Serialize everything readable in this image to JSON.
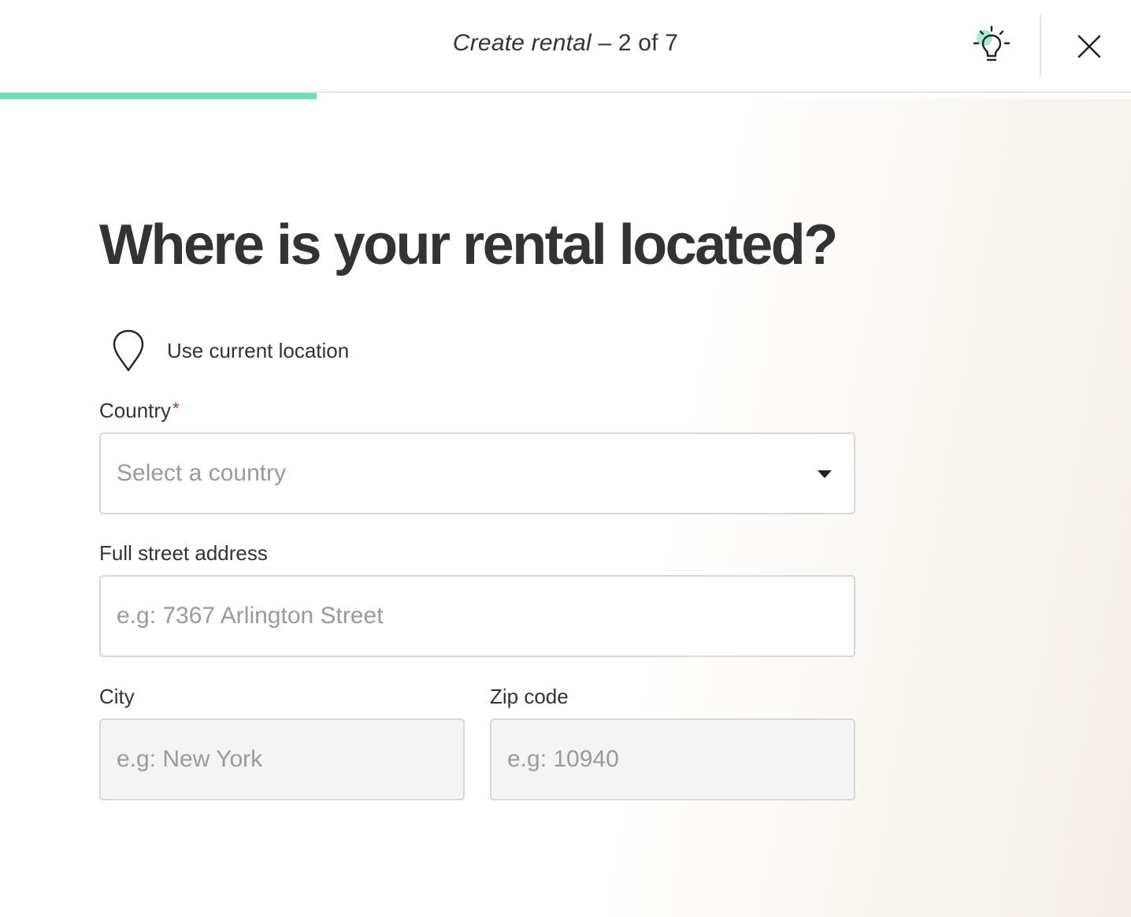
{
  "header": {
    "title_main": "Create rental",
    "title_step": " – 2 of 7",
    "idea_icon": "lightbulb-icon",
    "close_icon": "close-icon"
  },
  "progress": {
    "current_step": 2,
    "total_steps": 7,
    "fill_fraction": 0.28,
    "color": "#6fddb8"
  },
  "main": {
    "heading": "Where is your rental located?",
    "use_location": {
      "icon": "map-pin-icon",
      "label": "Use current location"
    }
  },
  "form": {
    "country": {
      "label": "Country",
      "required_mark": "*",
      "placeholder": "Select a country"
    },
    "street": {
      "label": "Full street address",
      "placeholder": "e.g: 7367 Arlington Street"
    },
    "city": {
      "label": "City",
      "placeholder": "e.g: New York"
    },
    "zip": {
      "label": "Zip code",
      "placeholder": "e.g: 10940"
    }
  },
  "colors": {
    "accent": "#6fddb8",
    "required": "#b4303a",
    "text": "#333333",
    "placeholder": "#9a9a9a"
  }
}
